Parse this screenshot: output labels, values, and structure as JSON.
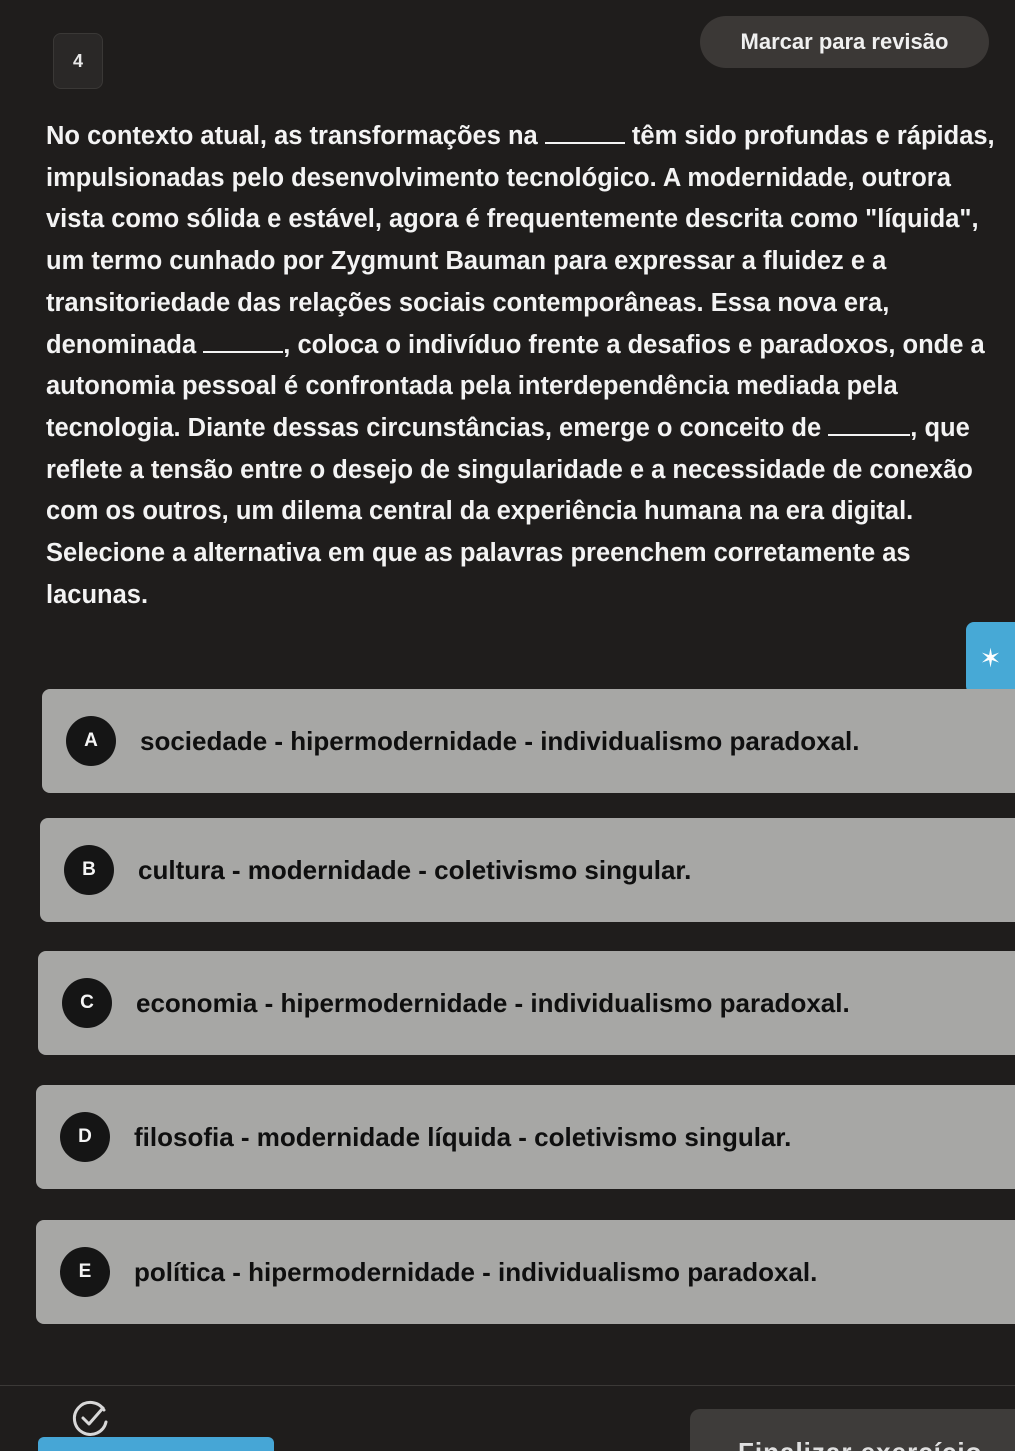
{
  "question": {
    "number": "4",
    "review_label": "Marcar para revisão",
    "statement_parts": {
      "p1": "No contexto atual, as transformações na ",
      "p2": " têm sido profundas e rápidas, impulsionadas pelo desenvolvimento tecnológico. A modernidade, outrora vista como sólida e estável, agora é frequentemente descrita como \"líquida\", um termo cunhado por Zygmunt Bauman para expressar a fluidez e a transitoriedade das relações sociais contemporâneas. Essa nova era, denominada ",
      "p3": ", coloca o indivíduo frente a desafios e paradoxos, onde a autonomia pessoal é confrontada pela interdependência mediada pela tecnologia. Diante dessas circunstâncias, emerge o conceito de ",
      "p4": ", que reflete a tensão entre o desejo de singularidade e a necessidade de conexão com os outros, um dilema central da experiência humana na era digital.",
      "instruction": "Selecione a alternativa em que as palavras preenchem corretamente as lacunas."
    }
  },
  "options": [
    {
      "letter": "A",
      "text": "sociedade - hipermodernidade - individualismo paradoxal."
    },
    {
      "letter": "B",
      "text": "cultura - modernidade - coletivismo singular."
    },
    {
      "letter": "C",
      "text": "economia - hipermodernidade - individualismo paradoxal."
    },
    {
      "letter": "D",
      "text": "filosofia - modernidade líquida - coletivismo singular."
    },
    {
      "letter": "E",
      "text": "política - hipermodernidade - individualismo paradoxal."
    }
  ],
  "footer": {
    "finish_label": "Finalizar exercício"
  },
  "colors": {
    "background": "#1f1d1c",
    "option_bg": "#a7a7a5",
    "accent": "#47a9d6"
  },
  "icons": {
    "side_tab": "sparkle-icon",
    "footer_check": "check-circle-icon"
  }
}
